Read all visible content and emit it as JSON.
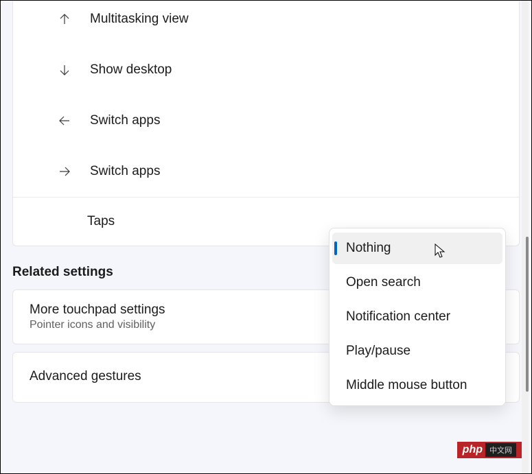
{
  "gestures": [
    {
      "label": "Multitasking view",
      "icon": "arrow-up"
    },
    {
      "label": "Show desktop",
      "icon": "arrow-down"
    },
    {
      "label": "Switch apps",
      "icon": "arrow-left"
    },
    {
      "label": "Switch apps",
      "icon": "arrow-right"
    }
  ],
  "taps_label": "Taps",
  "dropdown": {
    "options": [
      "Nothing",
      "Open search",
      "Notification center",
      "Play/pause",
      "Middle mouse button"
    ],
    "selected_index": 0
  },
  "related": {
    "heading": "Related settings",
    "items": [
      {
        "title": "More touchpad settings",
        "subtitle": "Pointer icons and visibility"
      },
      {
        "title": "Advanced gestures"
      }
    ]
  },
  "watermark": {
    "brand": "php",
    "suffix": "中文网"
  }
}
